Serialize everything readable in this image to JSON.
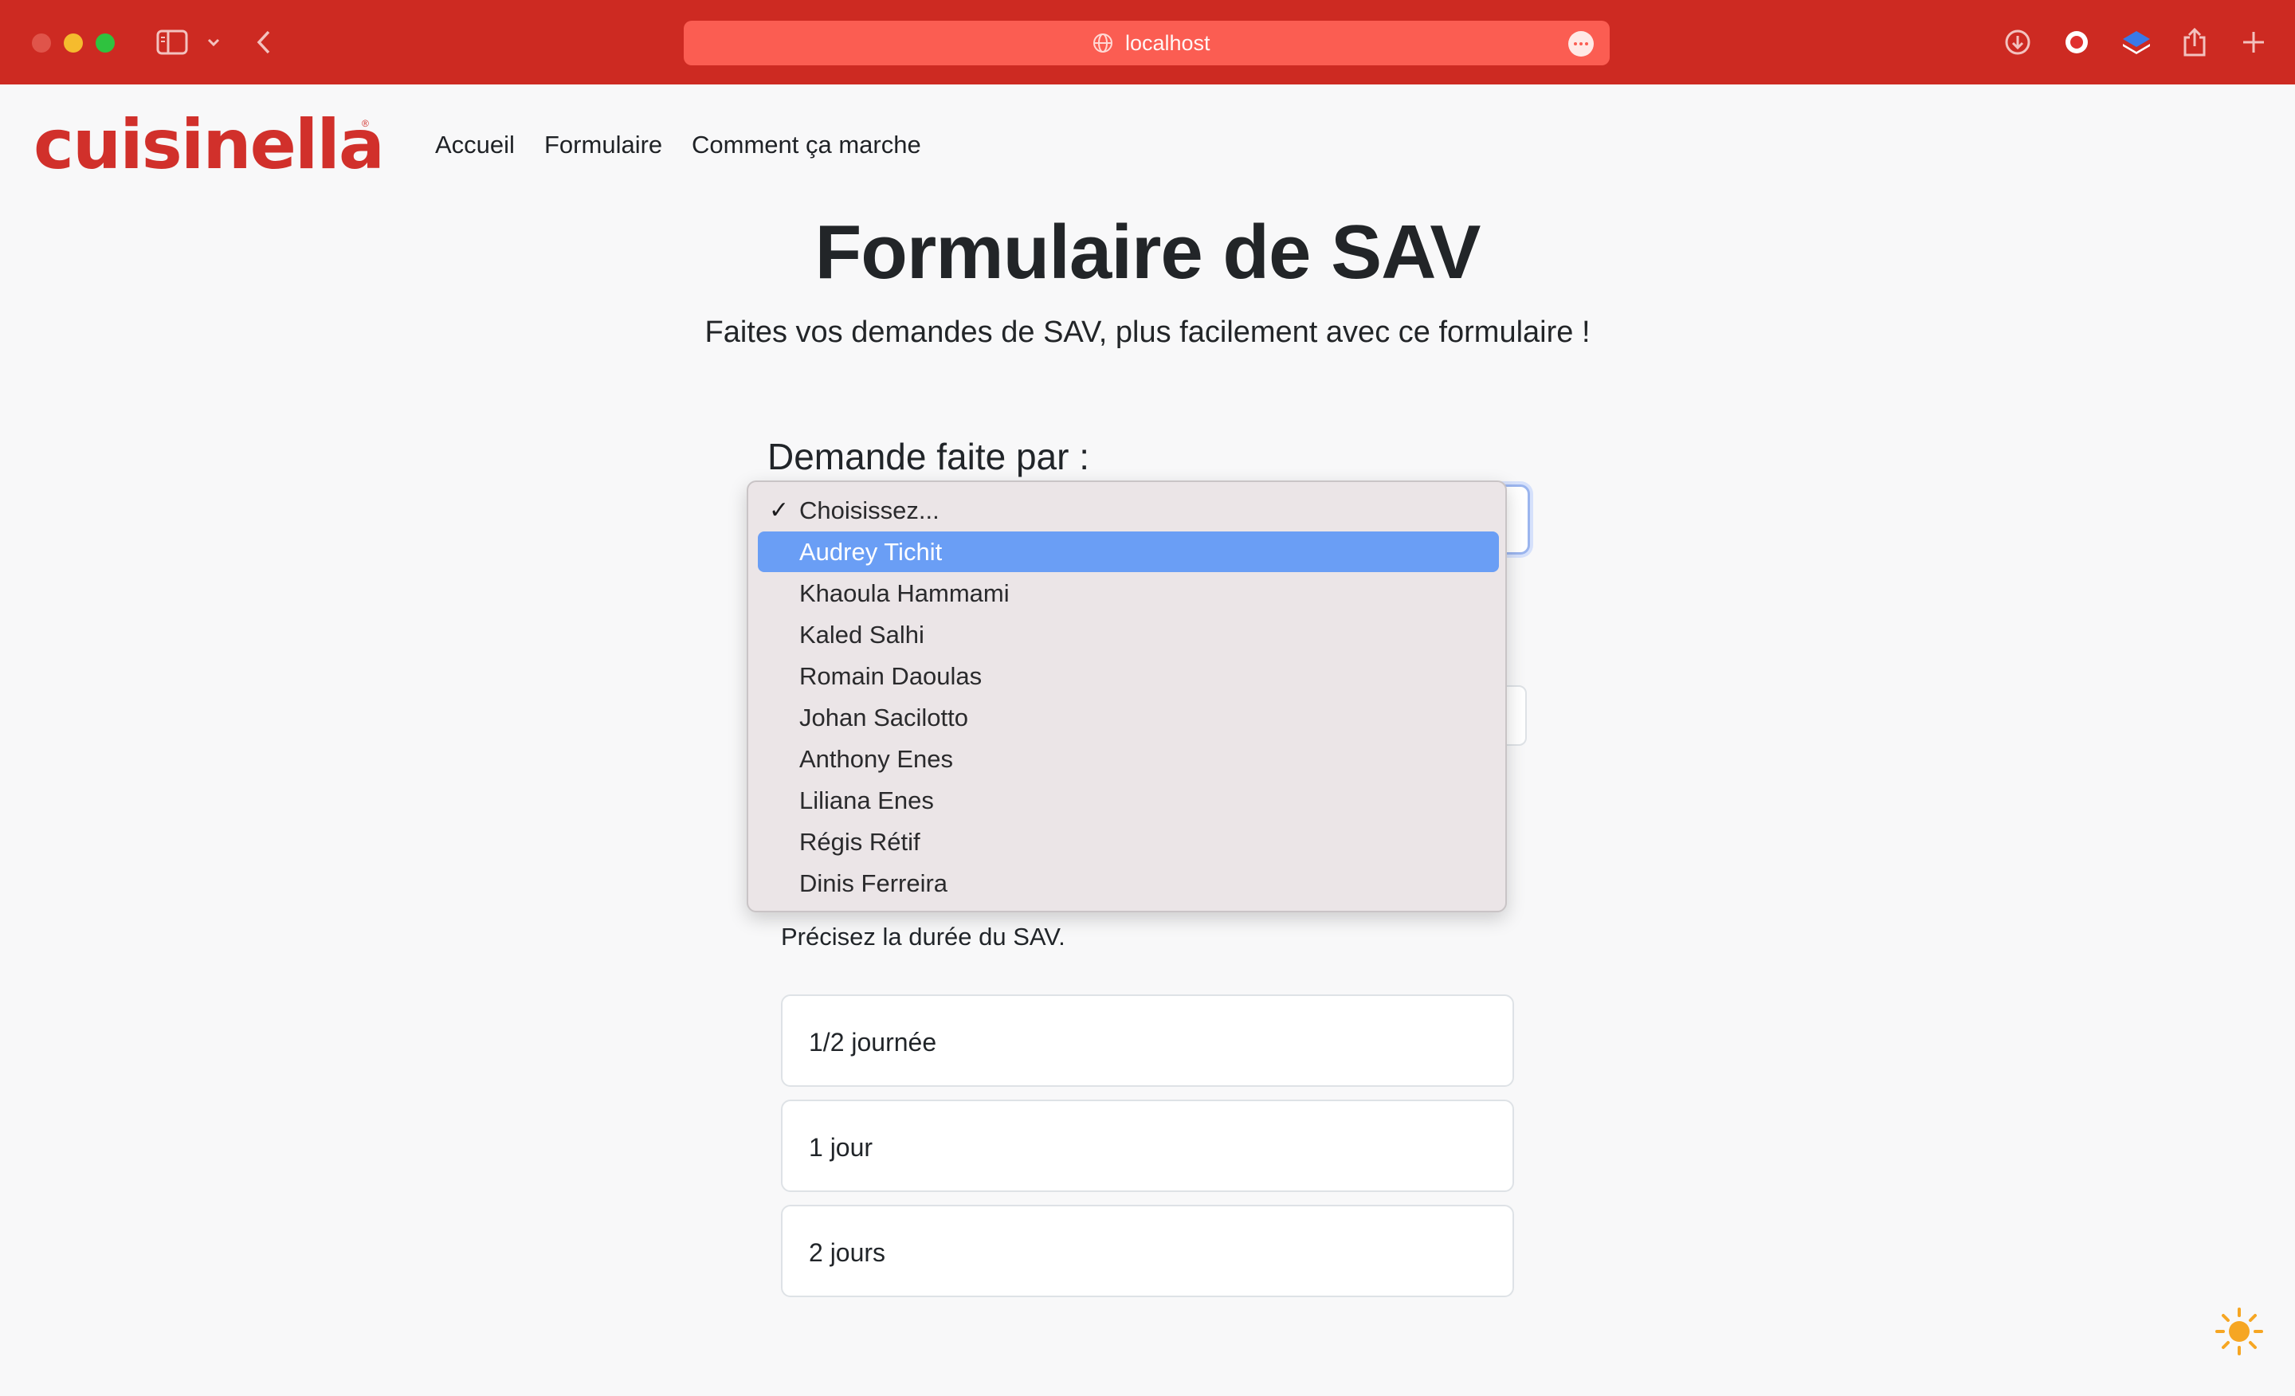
{
  "browser": {
    "url": "localhost",
    "colors": {
      "toolbar": "#cd2a22",
      "urlbar": "#fb5d52"
    }
  },
  "header": {
    "logo": "cuisinella",
    "logo_mark": "®",
    "nav": [
      "Accueil",
      "Formulaire",
      "Comment ça marche"
    ]
  },
  "main": {
    "title": "Formulaire de SAV",
    "subtitle": "Faites vos demandes de SAV, plus facilement avec ce formulaire !",
    "requester_label": "Demande faite par :",
    "requester_select": {
      "options": [
        "Choisissez...",
        "Audrey Tichit",
        "Khaoula Hammami",
        "Kaled Salhi",
        "Romain Daoulas",
        "Johan Sacilotto",
        "Anthony Enes",
        "Liliana Enes",
        "Régis Rétif",
        "Dinis Ferreira"
      ],
      "checked_index": 0,
      "highlighted_index": 1,
      "check_mark": "✓"
    },
    "duration_help": "Précisez la durée du SAV.",
    "duration_options": [
      "1/2 journée",
      "1 jour",
      "2 jours"
    ]
  },
  "theme_toggle_icon": "sun-icon",
  "accent_color": "#d1302b",
  "highlight_color": "#6a9ef5"
}
